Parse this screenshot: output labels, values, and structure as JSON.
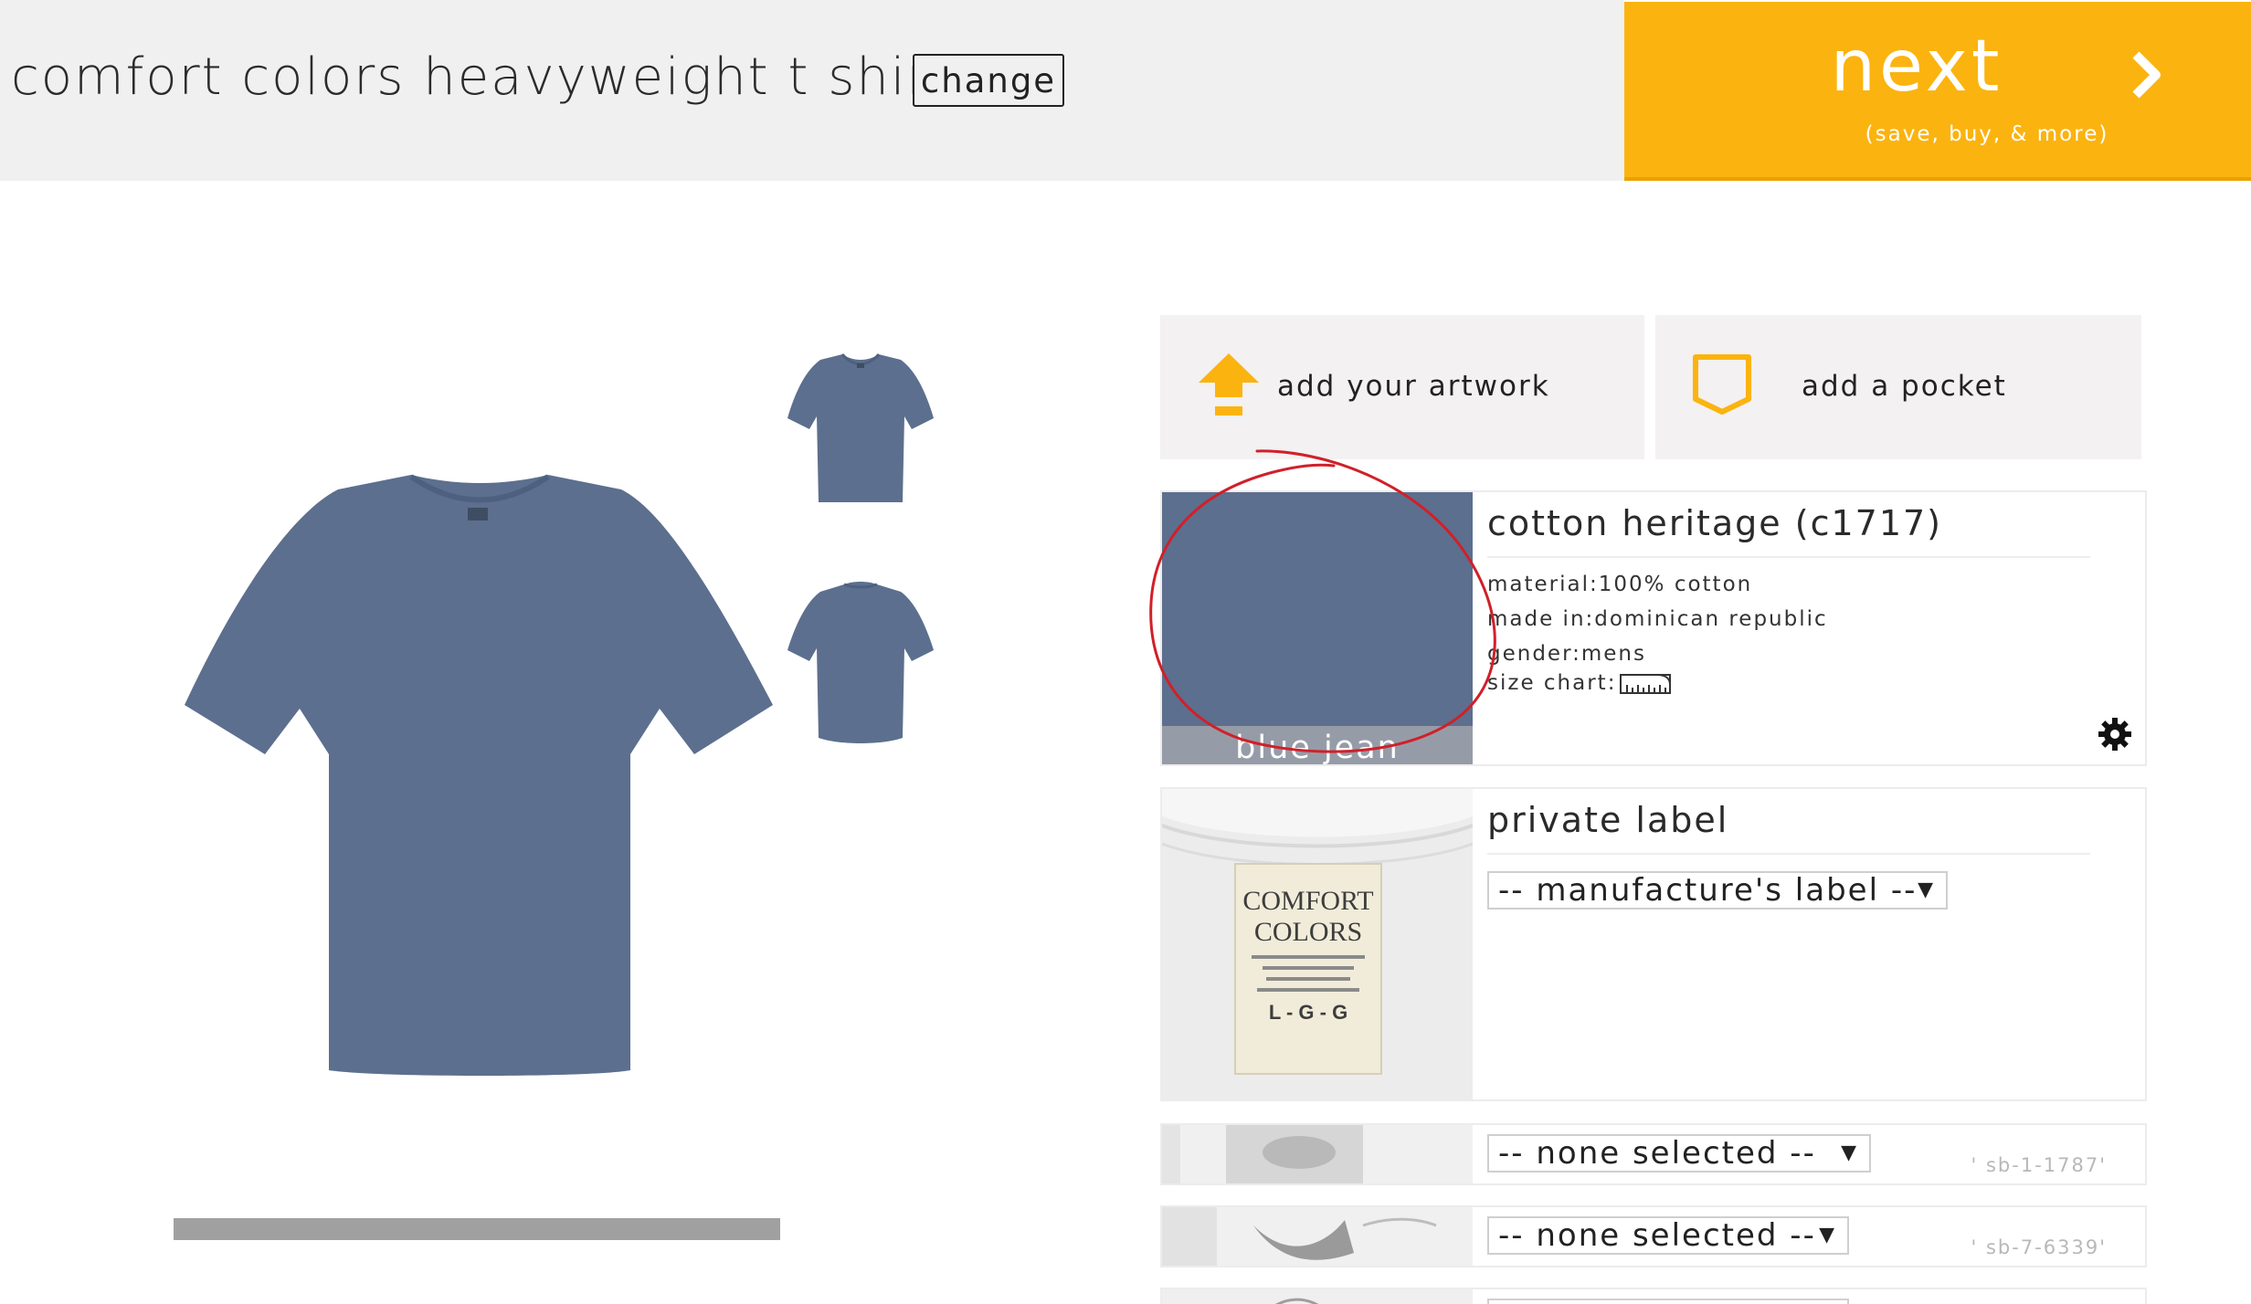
{
  "header": {
    "product_title": "comfort colors heavyweight t shirt",
    "change_label": "change",
    "next_label": "next",
    "next_sublabel": "(save, buy, & more)"
  },
  "colors": {
    "accent": "#fbb30f",
    "shirt": "#5c6f8e",
    "annotation": "#d0202a"
  },
  "actions": {
    "artwork_label": "add your artwork",
    "artwork_icon": "upload-arrow-icon",
    "pocket_label": "add a pocket",
    "pocket_icon": "pocket-icon"
  },
  "color_card": {
    "swatch_name": "blue jean",
    "title": "cotton heritage (c1717)",
    "material": "material:100% cotton",
    "made_in": "made in:dominican republic",
    "gender": "gender:mens",
    "size_chart": "size chart:",
    "size_chart_icon": "ruler-icon",
    "settings_icon": "gear-icon"
  },
  "label_card": {
    "title": "private label",
    "selected": "-- manufacture's label --",
    "tag_brand_1": "COMFORT",
    "tag_brand_2": "COLORS",
    "tag_sizes": "L - G - G"
  },
  "option_rows": [
    {
      "selected": "-- none selected --",
      "sku": "' sb-1-1787'"
    },
    {
      "selected": "-- none selected --",
      "sku": "' sb-7-6339'"
    }
  ]
}
